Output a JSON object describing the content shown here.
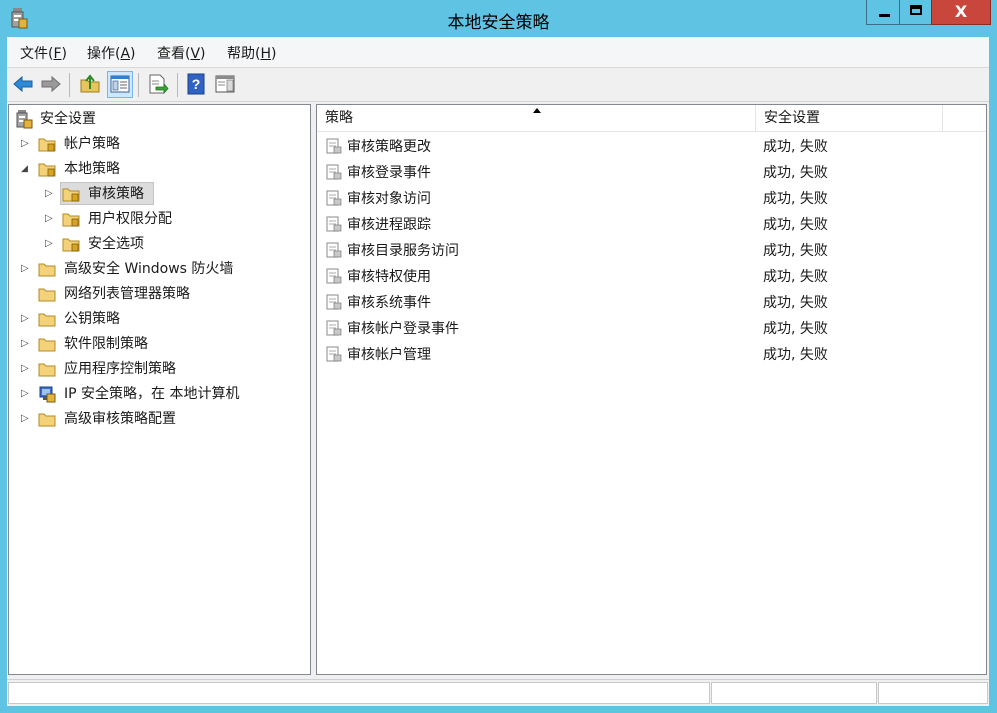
{
  "window": {
    "title": "本地安全策略"
  },
  "controls": {
    "minimize": "_",
    "maximize": "□",
    "close": "X"
  },
  "menu": [
    {
      "label": "文件(",
      "accel": "F",
      "tail": ")"
    },
    {
      "label": "操作(",
      "accel": "A",
      "tail": ")"
    },
    {
      "label": "查看(",
      "accel": "V",
      "tail": ")"
    },
    {
      "label": "帮助(",
      "accel": "H",
      "tail": ")"
    }
  ],
  "toolbar": {
    "icons": [
      "back-icon",
      "forward-icon",
      "up-folder-icon",
      "show-hide-console-tree-icon",
      "export-list-icon",
      "help-icon",
      "show-action-pane-icon"
    ]
  },
  "tree": {
    "root": "安全设置",
    "items": [
      {
        "label": "帐户策略",
        "expander": "▷"
      },
      {
        "label": "本地策略",
        "expander": "◢"
      },
      {
        "label": "审核策略",
        "expander": "▷"
      },
      {
        "label": "用户权限分配",
        "expander": "▷"
      },
      {
        "label": "安全选项",
        "expander": "▷"
      },
      {
        "label": "高级安全 Windows 防火墙",
        "expander": "▷"
      },
      {
        "label": "网络列表管理器策略",
        "expander": ""
      },
      {
        "label": "公钥策略",
        "expander": "▷"
      },
      {
        "label": "软件限制策略",
        "expander": "▷"
      },
      {
        "label": "应用程序控制策略",
        "expander": "▷"
      },
      {
        "label": "IP 安全策略，在 本地计算机",
        "expander": "▷"
      },
      {
        "label": "高级审核策略配置",
        "expander": "▷"
      }
    ]
  },
  "list": {
    "columns": [
      "策略",
      "安全设置"
    ],
    "sort_indicator": "▲",
    "rows": [
      {
        "policy": "审核策略更改",
        "setting": "成功, 失败"
      },
      {
        "policy": "审核登录事件",
        "setting": "成功, 失败"
      },
      {
        "policy": "审核对象访问",
        "setting": "成功, 失败"
      },
      {
        "policy": "审核进程跟踪",
        "setting": "成功, 失败"
      },
      {
        "policy": "审核目录服务访问",
        "setting": "成功, 失败"
      },
      {
        "policy": "审核特权使用",
        "setting": "成功, 失败"
      },
      {
        "policy": "审核系统事件",
        "setting": "成功, 失败"
      },
      {
        "policy": "审核帐户登录事件",
        "setting": "成功, 失败"
      },
      {
        "policy": "审核帐户管理",
        "setting": "成功, 失败"
      }
    ]
  },
  "colors": {
    "frame": "#5fc3e4",
    "close_button": "#c9463d",
    "selection": "#dcdcdc"
  }
}
